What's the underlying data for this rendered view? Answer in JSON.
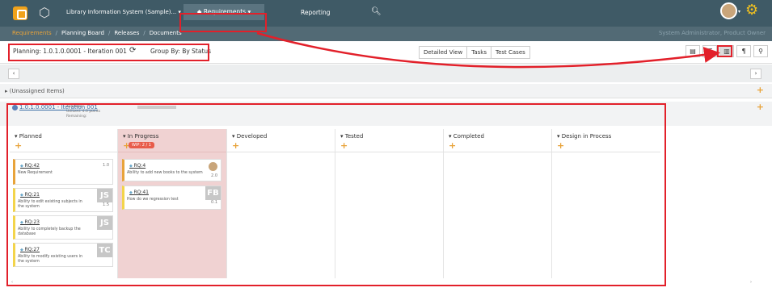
{
  "topnav": {
    "project": "Library Information System (Sample)... ▾",
    "requirements": "◆  Requirements ▾",
    "reporting": "Reporting",
    "search_icon": "search-icon",
    "gear_icon": "gear-icon"
  },
  "breadcrumb": {
    "items": [
      "Requirements",
      "Planning Board",
      "Releases",
      "Documents"
    ],
    "role": "System Administrator, Product Owner"
  },
  "toolbar": {
    "planning_label": "Planning:",
    "planning_value": "1.0.1.0.0001 - Iteration 001",
    "groupby_label": "Group By:",
    "groupby_value": "By Status",
    "views": [
      "Detailed View",
      "Tasks",
      "Test Cases"
    ],
    "icons": [
      "list-icon",
      "bullet-list-icon",
      "board-icon",
      "paragraph-icon",
      "hierarchy-icon"
    ]
  },
  "rows": {
    "unassigned": "(Unassigned Items)",
    "iteration_link": "1.0.1.0.0001 - Iteration 001",
    "stats_line1": "Available:",
    "stats_line2": "Utilized:    4.0 points",
    "stats_line3": "Remaining:"
  },
  "columns": [
    {
      "name": "▾  Planned"
    },
    {
      "name": "▾  In Progress",
      "wip": "WIP: 2 / 1"
    },
    {
      "name": "▾  Developed"
    },
    {
      "name": "▾  Tested"
    },
    {
      "name": "▾  Completed"
    },
    {
      "name": "▾  Design in Process"
    }
  ],
  "cards": {
    "rq42": {
      "ref": "RQ:42",
      "desc": "New Requirement",
      "pts": "1.0"
    },
    "rq21": {
      "ref": "RQ:21",
      "desc": "Ability to edit existing subjects in the system",
      "pts": "1.5",
      "initials": "JS"
    },
    "rq23": {
      "ref": "RQ:23",
      "desc": "Ability to completely backup the database",
      "initials": "JS"
    },
    "rq27": {
      "ref": "RQ:27",
      "desc": "Ability to modify existing users in the system",
      "initials": "TC"
    },
    "rq4": {
      "ref": "RQ:4",
      "desc": "Ability to add new books to the system",
      "pts": "2.0"
    },
    "rq41": {
      "ref": "RQ:41",
      "desc": "How do we regression test",
      "pts": "0.1",
      "initials": "FB"
    }
  },
  "colors": {
    "topbar": "#3f5a66",
    "accent": "#e8a33a",
    "inprogress": "#f0d2d2",
    "annotation": "#e2202a"
  }
}
